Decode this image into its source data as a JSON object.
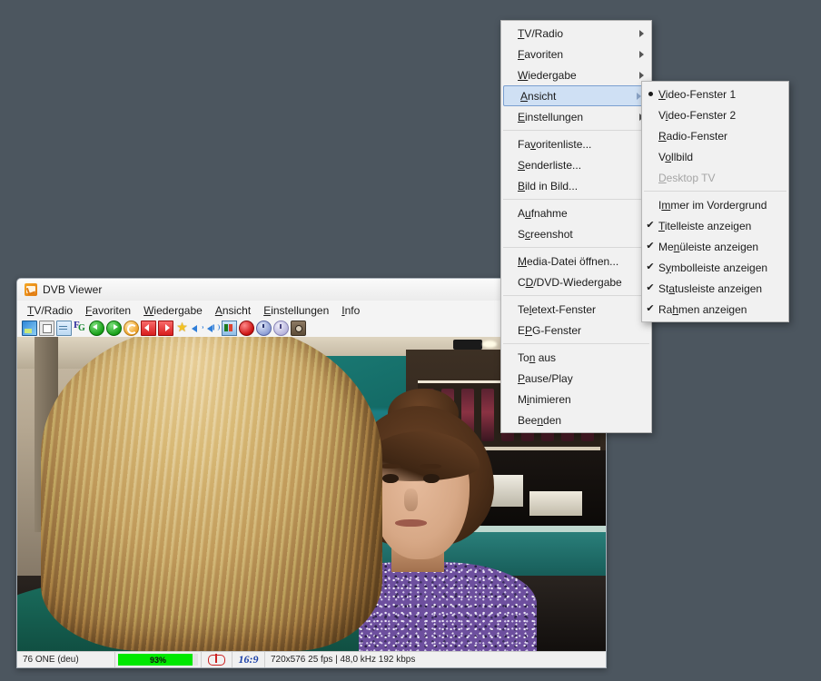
{
  "desktop": {
    "background_color": "#4c565f"
  },
  "window": {
    "title": "DVB Viewer",
    "icon": "dvb-viewer-app-icon",
    "menubar": [
      {
        "label": "TV/Radio",
        "accel_index": 1
      },
      {
        "label": "Favoriten",
        "accel_index": 0
      },
      {
        "label": "Wiedergabe",
        "accel_index": 0
      },
      {
        "label": "Ansicht",
        "accel_index": 0
      },
      {
        "label": "Einstellungen",
        "accel_index": 0
      },
      {
        "label": "Info",
        "accel_index": 0
      }
    ],
    "toolbar": [
      {
        "name": "channel-list-icon"
      },
      {
        "name": "window-list-icon"
      },
      {
        "name": "epg-list-icon"
      },
      {
        "name": "favorites-tree-icon"
      },
      {
        "name": "previous-back-icon"
      },
      {
        "name": "next-forward-icon"
      },
      {
        "name": "refresh-icon"
      },
      {
        "name": "previous-channel-icon"
      },
      {
        "name": "next-channel-icon"
      },
      {
        "name": "favorite-star-icon"
      },
      {
        "name": "volume-down-icon"
      },
      {
        "name": "volume-up-icon"
      },
      {
        "name": "teletext-icon"
      },
      {
        "name": "record-icon"
      },
      {
        "name": "timer-icon"
      },
      {
        "name": "clock-epg-icon"
      },
      {
        "name": "snapshot-camera-icon"
      }
    ],
    "statusbar": {
      "channel": "76 ONE (deu)",
      "signal_percent": "93%",
      "signal_value": 93,
      "signal_color": "#00e800",
      "closed_caption": "CC",
      "aspect_ratio": "16:9",
      "stream_info": "720x576 25 fps | 48,0 kHz 192 kbps"
    }
  },
  "context_menu": {
    "items": [
      {
        "label": "TV/Radio",
        "accel_index": 1,
        "submenu": true
      },
      {
        "label": "Favoriten",
        "accel_index": 0,
        "submenu": true
      },
      {
        "label": "Wiedergabe",
        "accel_index": 0,
        "submenu": true
      },
      {
        "label": "Ansicht",
        "accel_index": 0,
        "submenu": true,
        "highlighted": true
      },
      {
        "label": "Einstellungen",
        "accel_index": 0,
        "submenu": true
      },
      {
        "separator": true
      },
      {
        "label": "Favoritenliste...",
        "accel_index": 2
      },
      {
        "label": "Senderliste...",
        "accel_index": 0
      },
      {
        "label": "Bild in Bild...",
        "accel_index": 0
      },
      {
        "separator": true
      },
      {
        "label": "Aufnahme",
        "accel_index": 1
      },
      {
        "label": "Screenshot",
        "accel_index": 1
      },
      {
        "separator": true
      },
      {
        "label": "Media-Datei öffnen...",
        "accel_index": 0
      },
      {
        "label": "CD/DVD-Wiedergabe",
        "accel_index": 1
      },
      {
        "separator": true
      },
      {
        "label": "Teletext-Fenster",
        "accel_index": 2
      },
      {
        "label": "EPG-Fenster",
        "accel_index": 1
      },
      {
        "separator": true
      },
      {
        "label": "Ton aus",
        "accel_index": 2
      },
      {
        "label": "Pause/Play",
        "accel_index": 0
      },
      {
        "label": "Minimieren",
        "accel_index": 1
      },
      {
        "label": "Beenden",
        "accel_index": 3
      }
    ]
  },
  "view_submenu": {
    "items": [
      {
        "label": "Video-Fenster 1",
        "accel_index": 0,
        "mark": "radio"
      },
      {
        "label": "Video-Fenster 2",
        "accel_index": 1,
        "mark": "none"
      },
      {
        "label": "Radio-Fenster",
        "accel_index": 0,
        "mark": "none"
      },
      {
        "label": "Vollbild",
        "accel_index": 1,
        "mark": "none"
      },
      {
        "label": "Desktop TV",
        "accel_index": 0,
        "mark": "none",
        "disabled": true
      },
      {
        "separator": true
      },
      {
        "label": "Immer im Vordergrund",
        "accel_index": 1,
        "mark": "none"
      },
      {
        "label": "Titelleiste anzeigen",
        "accel_index": 0,
        "mark": "check"
      },
      {
        "label": "Menüleiste anzeigen",
        "accel_index": 2,
        "mark": "check"
      },
      {
        "label": "Symbolleiste anzeigen",
        "accel_index": 1,
        "mark": "check"
      },
      {
        "label": "Statusleiste anzeigen",
        "accel_index": 2,
        "mark": "check"
      },
      {
        "label": "Rahmen anzeigen",
        "accel_index": 2,
        "mark": "check"
      }
    ]
  },
  "glyphs": {
    "check": "✔",
    "arrow": "▶",
    "star": "★"
  }
}
